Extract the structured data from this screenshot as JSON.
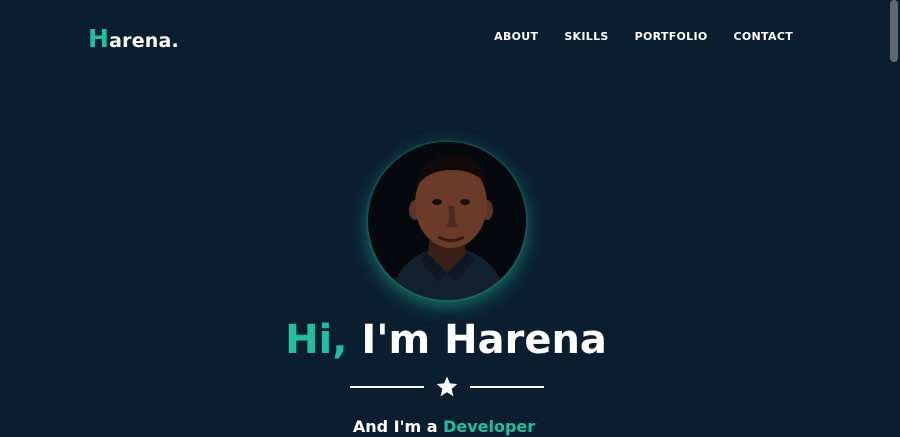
{
  "brand": {
    "logo_initial": "H",
    "logo_rest": "arena."
  },
  "nav": {
    "items": [
      {
        "label": "ABOUT"
      },
      {
        "label": "SKILLS"
      },
      {
        "label": "PORTFOLIO"
      },
      {
        "label": "CONTACT"
      }
    ]
  },
  "hero": {
    "greeting_prefix": "Hi,",
    "greeting_rest": " I'm Harena",
    "subtitle_prefix": "And I'm a ",
    "subtitle_role": "Developer",
    "divider_icon": "star-icon",
    "avatar_icon": "profile-photo"
  },
  "colors": {
    "background": "#0b1e2f",
    "accent": "#1fbf9f",
    "text": "#ffffff"
  }
}
